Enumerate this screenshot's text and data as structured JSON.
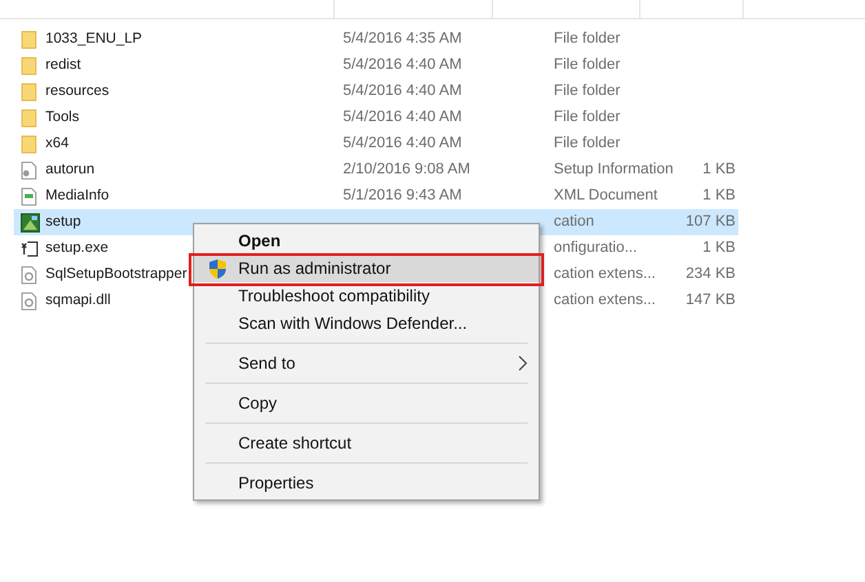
{
  "files": [
    {
      "name": "1033_ENU_LP",
      "kind": "folder",
      "date": "5/4/2016 4:35 AM",
      "type": "File folder",
      "selected": false
    },
    {
      "name": "redist",
      "kind": "folder",
      "date": "5/4/2016 4:40 AM",
      "type": "File folder",
      "selected": false
    },
    {
      "name": "resources",
      "kind": "folder",
      "date": "5/4/2016 4:40 AM",
      "type": "File folder",
      "selected": false
    },
    {
      "name": "Tools",
      "kind": "folder",
      "date": "5/4/2016 4:40 AM",
      "type": "File folder",
      "selected": false
    },
    {
      "name": "x64",
      "kind": "folder",
      "date": "5/4/2016 4:40 AM",
      "type": "File folder",
      "selected": false
    },
    {
      "name": "autorun",
      "kind": "settings",
      "date": "2/10/2016 9:08 AM",
      "type": "Setup Information",
      "size": "1 KB",
      "selected": false
    },
    {
      "name": "MediaInfo",
      "kind": "document",
      "date": "5/1/2016 9:43 AM",
      "type": "XML Document",
      "size": "1 KB",
      "selected": false
    },
    {
      "name": "setup",
      "kind": "application",
      "type": "cation",
      "size": "107 KB",
      "selected": true
    },
    {
      "name": "setup.exe",
      "kind": "config",
      "type": "onfiguratio...",
      "size": "1 KB",
      "selected": false
    },
    {
      "name": "SqlSetupBootstrapper",
      "kind": "library",
      "type": "cation extens...",
      "size": "234 KB",
      "selected": false
    },
    {
      "name": "sqmapi.dll",
      "kind": "library",
      "type": "cation extens...",
      "size": "147 KB",
      "selected": false
    }
  ],
  "context_menu": [
    {
      "kind": "default",
      "label": "Open",
      "selected": false
    },
    {
      "kind": "admin",
      "label": "Run as administrator",
      "selected": true
    },
    {
      "kind": "plain",
      "label": "Troubleshoot compatibility",
      "selected": false
    },
    {
      "kind": "plain",
      "label": "Scan with Windows Defender...",
      "selected": false
    },
    {
      "kind": "separator"
    },
    {
      "kind": "submenu",
      "label": "Send to",
      "selected": false
    },
    {
      "kind": "separator"
    },
    {
      "kind": "plain",
      "label": "Copy",
      "selected": false
    },
    {
      "kind": "separator"
    },
    {
      "kind": "plain",
      "label": "Create shortcut",
      "selected": false
    },
    {
      "kind": "separator"
    },
    {
      "kind": "plain",
      "label": "Properties",
      "selected": false
    }
  ]
}
